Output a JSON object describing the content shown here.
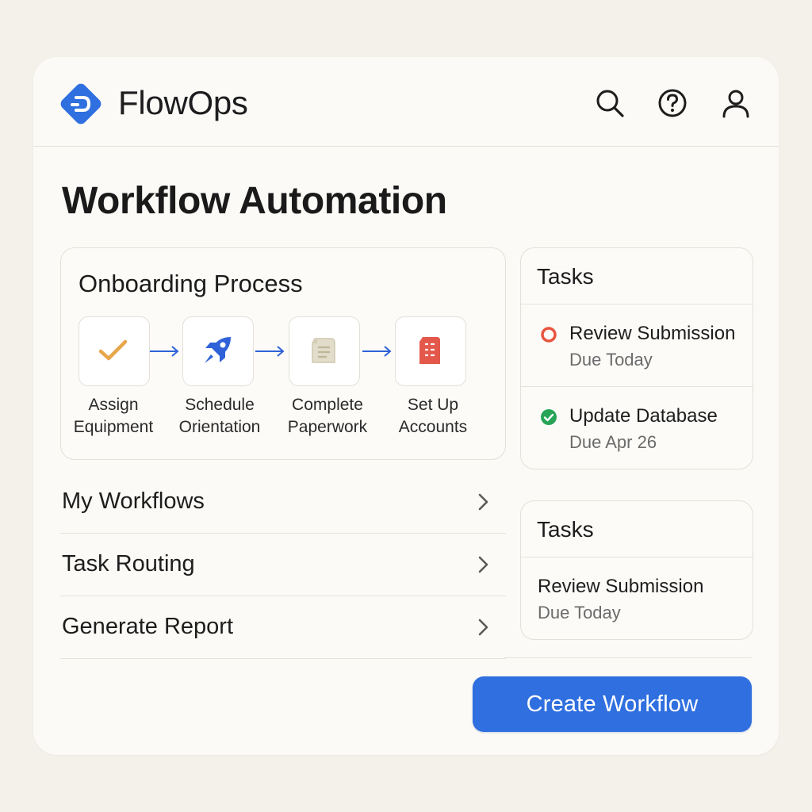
{
  "header": {
    "brand": "FlowOps",
    "logo_icon": "flowops-logo-icon",
    "icons": [
      "search-icon",
      "help-icon",
      "user-icon"
    ]
  },
  "page": {
    "title": "Workflow Automation"
  },
  "onboarding": {
    "title": "Onboarding Process",
    "steps": [
      {
        "line1": "Assign",
        "line2": "Equipment",
        "icon": "checkmark-icon",
        "color": "#e8a64c"
      },
      {
        "line1": "Schedule",
        "line2": "Orientation",
        "icon": "rocket-icon",
        "color": "#2f62d8"
      },
      {
        "line1": "Complete",
        "line2": "Paperwork",
        "icon": "document-icon",
        "color": "#d6d1bd"
      },
      {
        "line1": "Set Up",
        "line2": "Accounts",
        "icon": "server-icon",
        "color": "#e4584b"
      }
    ]
  },
  "nav": {
    "items": [
      {
        "label": "My Workflows"
      },
      {
        "label": "Task Routing"
      },
      {
        "label": "Generate Report"
      }
    ]
  },
  "tasks_primary": {
    "title": "Tasks",
    "items": [
      {
        "name": "Review Submission",
        "due": "Due Today",
        "status": "pending",
        "status_color": "#e8553f"
      },
      {
        "name": "Update Database",
        "due": "Due Apr 26",
        "status": "complete",
        "status_color": "#27a456"
      }
    ]
  },
  "tasks_secondary": {
    "title": "Tasks",
    "items": [
      {
        "name": "Review Submission",
        "due": "Due Today"
      }
    ]
  },
  "actions": {
    "create_label": "Create Workflow"
  },
  "colors": {
    "accent": "#2f6fdf",
    "background": "#f4f1ea",
    "card": "#fbfaf6"
  }
}
